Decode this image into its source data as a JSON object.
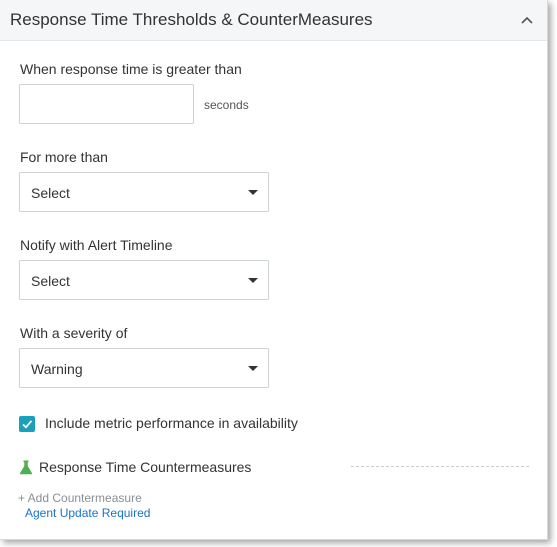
{
  "header": {
    "title": "Response Time Thresholds & CounterMeasures",
    "collapse_icon": "chevron-up-icon"
  },
  "form": {
    "response_time": {
      "label": "When response time is greater than",
      "value": "",
      "unit": "seconds"
    },
    "duration": {
      "label": "For more than",
      "selected": "Select"
    },
    "alert_timeline": {
      "label": "Notify with Alert Timeline",
      "selected": "Select"
    },
    "severity": {
      "label": "With a severity of",
      "selected": "Warning"
    },
    "availability_checkbox": {
      "label": "Include metric performance in availability",
      "checked": true
    }
  },
  "countermeasures": {
    "icon": "flask-icon",
    "title": "Response Time Countermeasures",
    "add_label": "+ Add Countermeasure",
    "agent_link": "Agent Update Required"
  },
  "colors": {
    "header_bg": "#f4f6f8",
    "checkbox_accent": "#1aa0b8",
    "flask_green": "#4caf50",
    "link_blue": "#1a73c9"
  }
}
